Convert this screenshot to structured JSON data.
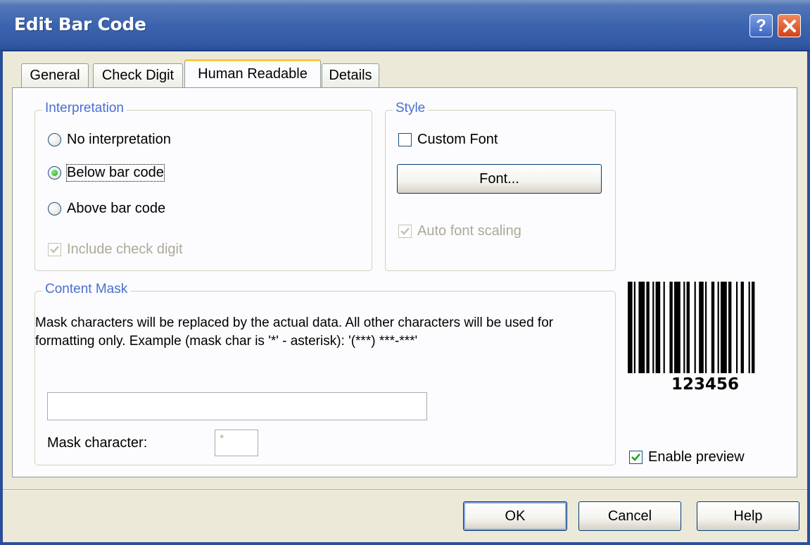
{
  "window": {
    "title": "Edit Bar Code",
    "help_glyph": "?"
  },
  "tabs": [
    {
      "label": "General",
      "active": false
    },
    {
      "label": "Check Digit",
      "active": false
    },
    {
      "label": "Human Readable",
      "active": true
    },
    {
      "label": "Details",
      "active": false
    }
  ],
  "interpretation": {
    "legend": "Interpretation",
    "options": [
      {
        "label": "No interpretation",
        "selected": false
      },
      {
        "label": "Below bar code",
        "selected": true
      },
      {
        "label": "Above bar code",
        "selected": false
      }
    ],
    "include_check_digit": {
      "label": "Include check digit",
      "checked": true,
      "enabled": false
    }
  },
  "style": {
    "legend": "Style",
    "custom_font": {
      "label": "Custom Font",
      "checked": false
    },
    "font_button": "Font...",
    "auto_font_scaling": {
      "label": "Auto font scaling",
      "checked": true,
      "enabled": false
    }
  },
  "content_mask": {
    "legend": "Content Mask",
    "description": "Mask characters will be replaced by the actual data. All other characters will be used for formatting only. Example (mask char is '*' - asterisk): '(***) ***-***'",
    "mask_value": "",
    "mask_character_label": "Mask character:",
    "mask_character_value": "*"
  },
  "preview": {
    "barcode_text": "123456",
    "enable_preview": {
      "label": "Enable preview",
      "checked": true
    }
  },
  "buttons": {
    "ok": "OK",
    "cancel": "Cancel",
    "help": "Help"
  },
  "colors": {
    "titlebar": "#3c64ae",
    "dialog_bg": "#ece9d8",
    "group_legend": "#4a6fd0",
    "active_tab_highlight": "#ffc83c",
    "check_green": "#21a121"
  }
}
